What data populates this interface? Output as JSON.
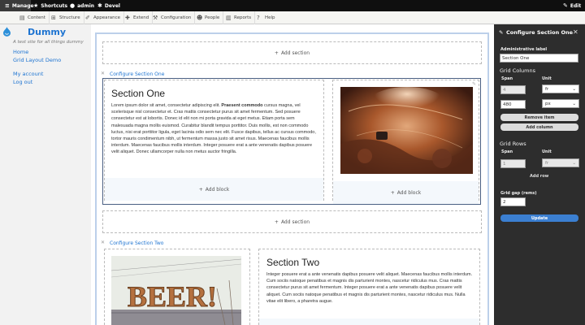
{
  "adminbar": {
    "manage": "Manage",
    "shortcuts": "Shortcuts",
    "user": "admin",
    "devel": "Devel",
    "edit": "Edit"
  },
  "toolbar": {
    "items": [
      {
        "label": "Content",
        "icon": "content-icon"
      },
      {
        "label": "Structure",
        "icon": "structure-icon"
      },
      {
        "label": "Appearance",
        "icon": "appearance-icon"
      },
      {
        "label": "Extend",
        "icon": "extend-icon"
      },
      {
        "label": "Configuration",
        "icon": "configuration-icon"
      },
      {
        "label": "People",
        "icon": "people-icon"
      },
      {
        "label": "Reports",
        "icon": "reports-icon"
      },
      {
        "label": "Help",
        "icon": "help-icon"
      }
    ]
  },
  "site": {
    "name": "Dummy",
    "slogan": "A test site for all things dummy",
    "nav": [
      "Home",
      "Grid Layout Demo",
      "My account",
      "Log out"
    ]
  },
  "builder": {
    "add_section": "Add section",
    "add_block": "Add block",
    "section_one_link": "Configure Section One",
    "section_two_link": "Configure Section Two",
    "section_one": {
      "title": "Section One",
      "body_lead": "Lorem ipsum dolor sit amet, consectetur adipiscing elit. ",
      "body_bold": "Praesent commodo",
      "body_rest": " cursus magna, vel scelerisque nisl consectetur et. Cras mattis consectetur purus sit amet fermentum. Sed posuere consectetur est at lobortis. Donec id elit non mi porta gravida at eget metus. Etiam porta sem malesuada magna mollis euismod. Curabitur blandit tempus porttitor. Duis mollis, est non commodo luctus, nisi erat porttitor ligula, eget lacinia odio sem nec elit. Fusce dapibus, tellus ac cursus commodo, tortor mauris condimentum nibh, ut fermentum massa justo sit amet risus. Maecenas faucibus mollis interdum. Maecenas faucibus mollis interdum. Integer posuere erat a ante venenatis dapibus posuere velit aliquet. Donec ullamcorper nulla non metus auctor fringilla."
    },
    "section_two": {
      "title": "Section Two",
      "body": "Integer posuere erat a ante venenatis dapibus posuere velit aliquet. Maecenas faucibus mollis interdum. Cum sociis natoque penatibus et magnis dis parturient montes, nascetur ridiculus mus. Cras mattis consectetur purus sit amet fermentum. Integer posuere erat a ante venenatis dapibus posuere velit aliquet. Cum sociis natoque penatibus et magnis dis parturient montes, nascetur ridiculus mus. Nulla vitae elit libero, a pharetra augue.",
      "sign_text": "BEER!"
    }
  },
  "panel": {
    "title": "Configure Section One",
    "admin_label_label": "Administrative label",
    "admin_label_value": "Section One",
    "grid_columns_heading": "Grid Columns",
    "span_label": "Span",
    "unit_label": "Unit",
    "col1_span": "4",
    "col1_unit": "fr",
    "col2_span": "480",
    "col2_unit": "px",
    "remove_item": "Remove item",
    "add_column": "Add column",
    "grid_rows_heading": "Grid Rows",
    "row1_span": "1",
    "row1_unit": "fr",
    "add_row": "Add row",
    "grid_gap_label": "Grid gap (rems)",
    "grid_gap_value": "2",
    "update": "Update"
  },
  "colors": {
    "accent": "#1e74d1",
    "admin_bar": "#0f0f0f",
    "panel_bg": "#2d2d2d",
    "update_button": "#3b7fd1"
  }
}
